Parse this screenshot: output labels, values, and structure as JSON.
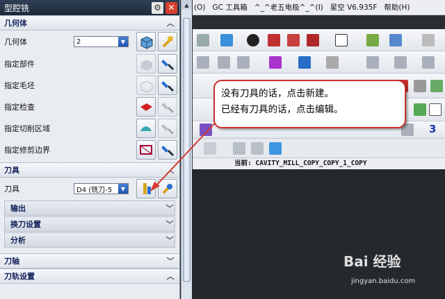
{
  "dialog": {
    "title": "型腔铣",
    "geometry": {
      "header": "几何体",
      "geometry_label": "几何体",
      "geometry_value": "2",
      "rows": [
        "指定部件",
        "指定毛坯",
        "指定检查",
        "指定切削区域",
        "指定修剪边界"
      ]
    },
    "tool": {
      "header": "刀具",
      "tool_label": "刀具",
      "tool_value": "D4 (铣刀-5"
    },
    "subsections": [
      "输出",
      "换刀设置",
      "分析"
    ],
    "axis_header": "刀轴",
    "path_settings_header": "刀轨设置"
  },
  "app": {
    "menu": [
      "(O)",
      "GC 工具箱",
      "^_^老五电极^_^(I)",
      "星空 V6.935F",
      "帮助(H)"
    ],
    "status_prefix": "当前:",
    "status_value": "CAVITY_MILL_COPY_COPY_1_COPY",
    "toolbar_number": "3"
  },
  "callout": {
    "line1": "没有刀具的话，点击新建。",
    "line2": "已经有刀具的话，点击编辑。"
  },
  "watermark": {
    "brand": "Bai 经验",
    "url": "jingyan.baidu.com"
  },
  "colors": {
    "callout_border": "#c9302c",
    "arrow": "#d83a2e",
    "section_text": "#12205a"
  }
}
